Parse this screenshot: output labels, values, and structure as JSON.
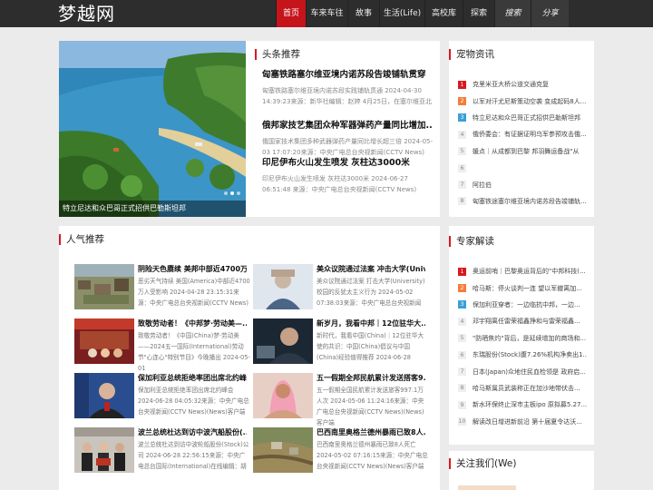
{
  "site": {
    "logo": "梦越网"
  },
  "nav": [
    {
      "label": "首页",
      "active": true
    },
    {
      "label": "车来车往"
    },
    {
      "label": "故事"
    },
    {
      "label": "生活(Life)"
    },
    {
      "label": "高校库"
    },
    {
      "label": "探索"
    },
    {
      "label": "搜索",
      "alt": true
    },
    {
      "label": "分享",
      "alt": true
    }
  ],
  "hero": {
    "caption": "特立尼达和众巴哥正式招供巴勒斯坦邦"
  },
  "headlines": {
    "title": "头条推荐",
    "items": [
      {
        "title": "匈塞铁路塞尔维亚境内诺苏段告竣铺轨贯穿",
        "summary": "匈塞铁路塞尔维亚境内诺苏段实践铺轨贯通 2024-04-30 14:39:23来源：新华社编辑：赵婷 4月25日，在塞尔维亚北"
      },
      {
        "title": "俄邦家技艺集团众种军器弹药产量同比增加...",
        "summary": "俄国家技术集团多种武器弹药产量同比增长超三倍 2024-05-03 17:07:20来源：中央广电总台央视新闻(CCTV News)"
      },
      {
        "title": "印尼伊布火山发生喷发 灰柱达3000米",
        "summary": "印尼伊布火山发生喷发 灰柱达3000米 2024-06-27 06:51:48 来源：中央广电总台央视新闻(CCTV News)(News)客户端编"
      }
    ]
  },
  "hot": {
    "title": "宠物资讯",
    "items": [
      "克里米亚大桥公道交通克复",
      "以军对汗尤尼斯策动空袭 变成起码8人...",
      "特立尼达和众巴哥正式招供巴勒斯坦邦",
      "俄侨委会：有证据证明乌军参预攻击俄...",
      "媛点｜从成都到巴黎 邦羽舞运备战\"从",
      "",
      "阿拉伯",
      "匈塞铁途塞尔维亚境内诺苏段告竣铺轨..."
    ]
  },
  "expert": {
    "title": "专家解读",
    "items": [
      "奥运前哨｜巴黎奥运背后的\"中邦科技(...",
      "哈马斯：停火谈判一连 望以军撤离加...",
      "保加利亚穿者：一边临抗中邦，一边...",
      "邓宇翔离任雷荣福鑫挣和与雷荣福鑫...",
      "\"防晒焦灼\"背后，是延续增加的商场和...",
      "东瑞股份(Stock)腹7.26%机构净卖出1...",
      "日本(Japan)众地住民血检领是 政府启...",
      "哈马斯属员武装称正在加沙地带伏击...",
      "新水环保终止深市主板ipo 原拟募5.27...",
      "解读改日增进新前沿 第十届夏令达沃..."
    ]
  },
  "follow": {
    "title": "关注我们(We)"
  },
  "popular": {
    "title": "人气推荐",
    "items": [
      {
        "title": "阴险天色赓续 美邦中部近4700万...",
        "summary": "恶劣天气持续 美国(America)中部近4700万人受影响 2024-04-28 23:15:31来源：中央广电总台央视新闻(CCTV News)"
      },
      {
        "title": "美众议院通过法案 冲击大学(Univ...",
        "summary": "美众议院通过法案 打击大学(University)校园的反犹太主义行为 2024-05-02 07:38:03来源：中央广电总台央视新闻"
      },
      {
        "title": "致敬劳动者！《中邦梦·劳动美—...",
        "summary": "致敬劳动者！《中国(China)梦·劳动美——2024五一国际(International)劳动节\"心连心\"特别节目》今晚播出 2024-05-01"
      },
      {
        "title": "新岁月，我看中邦｜12位驻华大...",
        "summary": "新时代，我看中国(China)｜12位驻华大使的共识：中国(China)倡议与中国(China)经验值得推荐 2024-06-28"
      },
      {
        "title": "保加利亚总统拒绝率团出席北约峰...",
        "summary": "保加利亚总统拒绝率团出席北约峰会 2024-06-28 04:05:32来源：中央广电总台央视新闻(CCTV News)(News)客户端"
      },
      {
        "title": "五一假期全邦民航累计发送搭客9...",
        "summary": "五一假期全国民航累计发送旅客997.1万人次 2024-05-06 11:24:16来源：中央广电总台央视新闻(CCTV News)(News)客户端"
      },
      {
        "title": "波兰总统杜达到访中波汽船股份(...",
        "summary": "波兰总统杜达到访中波轮船股份(Stock)公司 2024-06-28 22:56:15来源：中央广电总台国际(International)在线编辑：胡"
      },
      {
        "title": "巴西南里奥格兰德州暴雨已致8人...",
        "summary": "巴西南里奥格兰德州暴雨已致8人死亡 2024-05-02 07:16:15来源：中央广电总台央视新闻(CCTV News)(News)客户端"
      }
    ]
  }
}
